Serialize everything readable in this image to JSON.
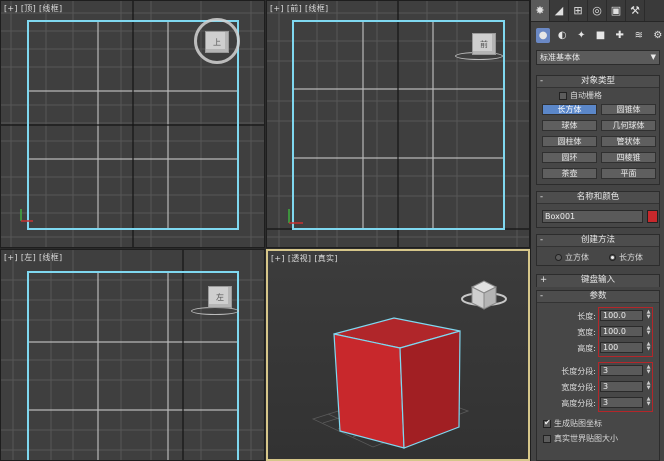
{
  "viewports": {
    "top": {
      "plus": "[+]",
      "view": "[顶]",
      "mode": "[线框]",
      "cube_label": "上"
    },
    "front": {
      "plus": "[+]",
      "view": "[前]",
      "mode": "[线框]",
      "cube_label": "前"
    },
    "left": {
      "plus": "[+]",
      "view": "[左]",
      "mode": "[线框]",
      "cube_label": "左"
    },
    "perspective": {
      "plus": "[+]",
      "view": "[透视]",
      "mode": "[真实]"
    }
  },
  "panel": {
    "tabs": [
      "create-icon",
      "modify-icon",
      "hierarchy-icon",
      "motion-icon",
      "display-icon",
      "utilities-icon"
    ],
    "create_icons": [
      "geometry-icon",
      "shapes-icon",
      "lights-icon",
      "cameras-icon",
      "helpers-icon",
      "spacewarps-icon",
      "systems-icon"
    ],
    "category": "标准基本体",
    "object_type": {
      "title": "对象类型",
      "autogrid": "自动栅格",
      "buttons": [
        "长方体",
        "圆锥体",
        "球体",
        "几何球体",
        "圆柱体",
        "管状体",
        "圆环",
        "四棱锥",
        "茶壶",
        "平面"
      ]
    },
    "name_color": {
      "title": "名称和颜色",
      "name": "Box001",
      "color": "#c8282c"
    },
    "creation_method": {
      "title": "创建方法",
      "opt1": "立方体",
      "opt2": "长方体"
    },
    "keyboard_entry": {
      "title": "键盘输入"
    },
    "params": {
      "title": "参数",
      "length_label": "长度:",
      "length": "100.0",
      "width_label": "宽度:",
      "width": "100.0",
      "height_label": "高度:",
      "height": "100",
      "lseg_label": "长度分段:",
      "lseg": "3",
      "wseg_label": "宽度分段:",
      "wseg": "3",
      "hseg_label": "高度分段:",
      "hseg": "3",
      "gen_map": "生成贴图坐标",
      "real_world": "真实世界贴图大小"
    }
  },
  "colors": {
    "accent_blue": "#5b87c9",
    "selection_cyan": "#7fd8f0",
    "box_red": "#c8282c",
    "highlight_red": "#b4262a"
  }
}
